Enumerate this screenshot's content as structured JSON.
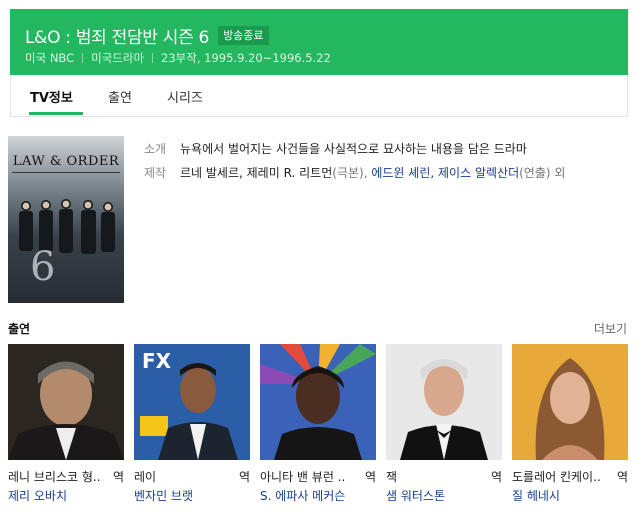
{
  "header": {
    "title": "L&O : 범죄 전담반 시즌 6",
    "badge": "방송종료",
    "meta": [
      "미국 NBC",
      "미국드라마",
      "23부작, 1995.9.20~1996.5.22"
    ]
  },
  "tabs": [
    {
      "label": "TV정보",
      "active": true
    },
    {
      "label": "출연",
      "active": false
    },
    {
      "label": "시리즈",
      "active": false
    }
  ],
  "poster": {
    "logo_text": "LAW & ORDER",
    "season_number": "6"
  },
  "info": {
    "intro_label": "소개",
    "intro_text": "뉴욕에서 벌어지는 사건들을 사실적으로 묘사하는 내용을 담은 드라마",
    "production_label": "제작",
    "writers": "르네 발세르, 제레미 R. 리트먼",
    "writers_role": "(극본),",
    "directors_1": "에드윈 셰린,",
    "directors_2": "제이스 알렉산더",
    "directors_role": "(연출) 외"
  },
  "cast_section": {
    "title": "출연",
    "more_label": "더보기",
    "cards": [
      {
        "role": "레니 브리스코 형..",
        "suffix": "역",
        "actor": "제리 오바치",
        "bg": "#2b2620"
      },
      {
        "role": "레이",
        "suffix": "역",
        "actor": "벤자민 브랫",
        "bg": "#2a5fa8"
      },
      {
        "role": "아니타 밴 뷰런 ..",
        "suffix": "역",
        "actor": "S. 에파사 메커슨",
        "bg": "#3a63b8"
      },
      {
        "role": "잭",
        "suffix": "역",
        "actor": "샘 워터스톤",
        "bg": "#e8e8e8"
      },
      {
        "role": "도를레어 킨케이..",
        "suffix": "역",
        "actor": "질 헤네시",
        "bg": "#e6a93a"
      }
    ]
  }
}
